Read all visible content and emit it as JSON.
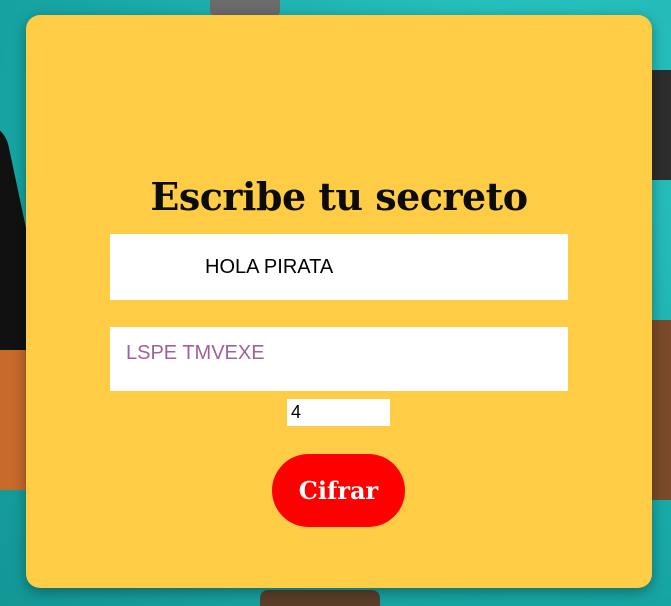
{
  "title": "Escribe tu secreto",
  "plain_input": {
    "value": "HOLA PIRATA"
  },
  "cipher_output": {
    "value": "LSPE TMVEXE"
  },
  "shift_input": {
    "value": "4"
  },
  "cipher_button": {
    "label": "Cifrar"
  },
  "colors": {
    "card_background": "#ffcd45",
    "button": "#ff0000",
    "button_text": "#ffffff",
    "cipher_text": "#a0619a",
    "page_background": "#1fb5b3"
  }
}
